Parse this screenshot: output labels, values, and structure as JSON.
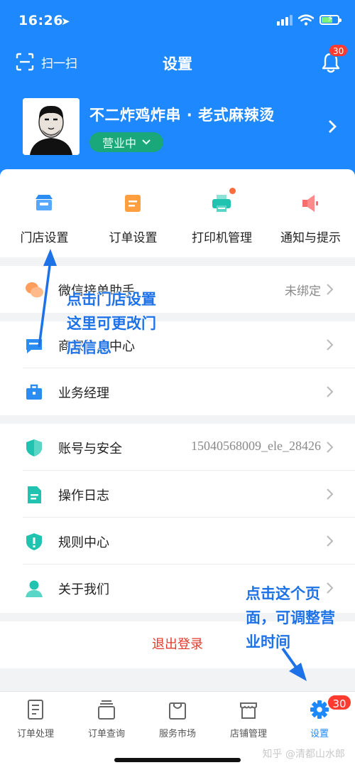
{
  "status_bar": {
    "time": "16:26"
  },
  "header": {
    "scan_label": "扫一扫",
    "title": "设置",
    "notification_badge": "30",
    "store_name": "不二炸鸡炸串 · 老式麻辣烫",
    "store_status": "营业中"
  },
  "shortcuts": [
    {
      "label": "门店设置",
      "icon": "store-settings-icon"
    },
    {
      "label": "订单设置",
      "icon": "order-settings-icon"
    },
    {
      "label": "打印机管理",
      "icon": "printer-icon"
    },
    {
      "label": "通知与提示",
      "icon": "speaker-icon"
    }
  ],
  "menu": {
    "wechat": {
      "label": "微信接单助手",
      "value": "未绑定"
    },
    "merchant": {
      "label": "商家信息中心"
    },
    "manager": {
      "label": "业务经理"
    },
    "account": {
      "label": "账号与安全",
      "value": "15040568009_ele_28426"
    },
    "oplog": {
      "label": "操作日志"
    },
    "rules": {
      "label": "规则中心"
    },
    "about": {
      "label": "关于我们"
    }
  },
  "logout_label": "退出登录",
  "tabs": [
    {
      "label": "订单处理"
    },
    {
      "label": "订单查询"
    },
    {
      "label": "服务市场"
    },
    {
      "label": "店铺管理"
    },
    {
      "label": "设置"
    }
  ],
  "tab_badge": "30",
  "annotations": {
    "store_settings_tip": [
      "点击门店设置",
      "这里可更改门",
      "店信息"
    ],
    "settings_tab_tip": [
      "点击这个页",
      "面，可调整营",
      "业时间"
    ]
  },
  "watermark": "知乎 @清都山水郎",
  "colors": {
    "header_blue": "#1e88ff",
    "status_green": "#1aa87a",
    "logout_red": "#e33a2c",
    "badge_red": "#ff3b30",
    "annotation_blue": "#1e72e8"
  }
}
